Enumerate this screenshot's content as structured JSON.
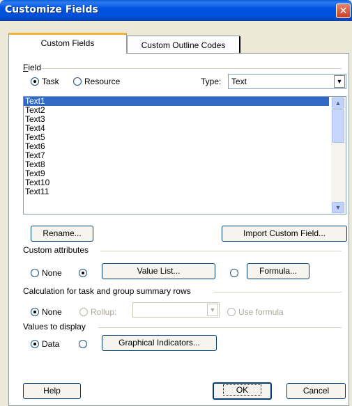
{
  "window": {
    "title": "Customize Fields",
    "close_glyph": "✕"
  },
  "tabs": [
    {
      "label": "Custom Fields",
      "active": true
    },
    {
      "label": "Custom Outline Codes",
      "active": false
    }
  ],
  "field_group": {
    "label": "Field",
    "task_label": "Task",
    "resource_label": "Resource",
    "type_label": "Type:",
    "type_value": "Text"
  },
  "fields_list": {
    "items": [
      "Text1",
      "Text2",
      "Text3",
      "Text4",
      "Text5",
      "Text6",
      "Text7",
      "Text8",
      "Text9",
      "Text10",
      "Text11"
    ],
    "selected_index": 0
  },
  "buttons": {
    "rename": "Rename...",
    "import": "Import Custom Field...",
    "value_list": "Value List...",
    "formula": "Formula...",
    "graphical_indicators": "Graphical Indicators...",
    "help": "Help",
    "ok": "OK",
    "cancel": "Cancel"
  },
  "custom_attributes": {
    "label": "Custom attributes",
    "none_label": "None"
  },
  "calculation": {
    "label": "Calculation for task and group summary rows",
    "none_label": "None",
    "rollup_label": "Rollup:",
    "use_formula_label": "Use formula"
  },
  "values_display": {
    "label": "Values to display",
    "data_label": "Data"
  },
  "icons": {
    "close": "close-icon",
    "dropdown": "chevron-down-icon",
    "scroll_up": "scroll-up-icon",
    "scroll_down": "scroll-down-icon"
  }
}
